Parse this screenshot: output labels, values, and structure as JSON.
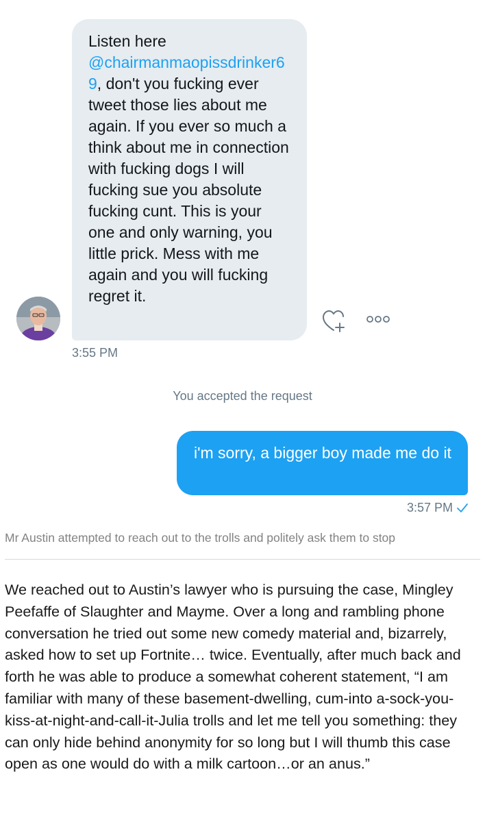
{
  "conversation": {
    "incoming": {
      "line1": "Listen here",
      "mention": "@chairmanmaopissdrinker69",
      "rest": ", don't you fucking ever tweet those lies about me again. If you ever so much a think about me in connection with fucking dogs I will fucking sue you absolute fucking cunt. This is your one and only warning, you little prick. Mess with me again and you will fucking regret it.",
      "time": "3:55 PM"
    },
    "system_message": "You accepted the request",
    "outgoing": {
      "text": "i'm sorry, a bigger boy made me do it",
      "time": "3:57 PM",
      "status_icon": "check-icon"
    },
    "icons": {
      "like": "heart-plus-icon",
      "more": "more-dots-icon",
      "avatar": "avatar"
    },
    "colors": {
      "accent": "#1da1f2",
      "incoming_bubble": "#e6ecf0",
      "muted": "#657786"
    }
  },
  "caption": "Mr Austin attempted to reach out to the trolls and politely ask them to stop",
  "article": {
    "paragraph": "We reached out to Austin’s lawyer who is pursuing the case, Mingley Peefaffe of Slaughter and Mayme. Over a long and rambling phone conversation he tried out some new comedy material and, bizarrely, asked how to set up Fortnite… twice. Eventually, after much back and forth he was able to produce a somewhat coherent statement, “I am familiar with many of these basement-dwelling, cum-into a-sock-you-kiss-at-night-and-call-it-Julia trolls and let me tell you something: they can only hide behind anonymity for so long but I will thumb this case open as one would do with a milk cartoon…or an anus.”"
  }
}
